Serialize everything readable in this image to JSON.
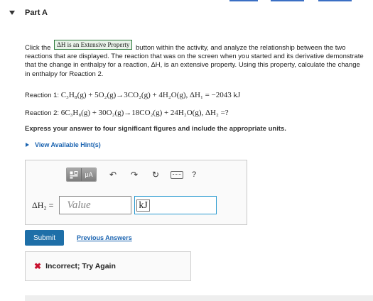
{
  "part": {
    "title": "Part A"
  },
  "paragraph": {
    "pre": "Click the",
    "button_label": "ΔH is an Extensive Property",
    "post": "button within the activity, and analyze the relationship between the two reactions that are displayed. The reaction that was on the screen when you started and its derivative demonstrate that the change in enthalpy for a reaction, ΔH, is an extensive property. Using this property, calculate the change in enthalpy for Reaction 2."
  },
  "reactions": [
    {
      "label": "Reaction 1:",
      "equation": "C₃H₈(g) + 5O₂(g)→3CO₂(g) + 4H₂O(g), ΔH₁ = −2043 kJ"
    },
    {
      "label": "Reaction 2:",
      "equation": "6C₃H₈(g) + 30O₂(g)→18CO₂(g) + 24H₂O(g), ΔH₂ =?"
    }
  ],
  "instruction": "Express your answer to four significant figures and include the appropriate units.",
  "hints": {
    "label": "View Available Hint(s)"
  },
  "toolbar": {
    "templates_icon": "template-icon",
    "units_label": "μA",
    "undo_icon": "undo-icon",
    "redo_icon": "redo-icon",
    "reset_icon": "reset-icon",
    "keyboard_icon": "keyboard-icon",
    "help_label": "?"
  },
  "answer": {
    "label": "ΔH₂ =",
    "value_placeholder": "Value",
    "unit_value": "kJ"
  },
  "buttons": {
    "submit": "Submit",
    "previous_answers": "Previous Answers"
  },
  "result": {
    "text": "Incorrect; Try Again"
  },
  "colors": {
    "accent": "#1e6fa8",
    "link": "#1a63b0",
    "error": "#c8102e"
  }
}
